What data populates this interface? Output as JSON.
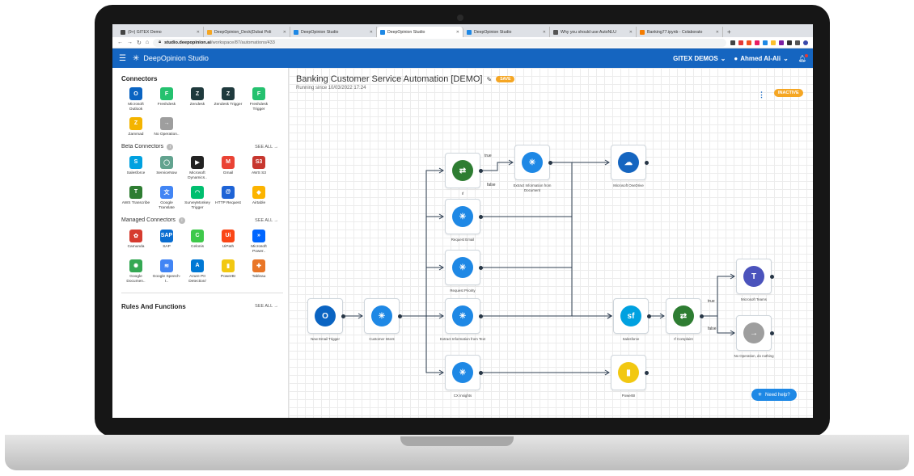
{
  "browser": {
    "tabs": [
      {
        "title": "(9+) GITEX Demo",
        "color": "#444"
      },
      {
        "title": "DeepOpinion_Deck(Dubai Poli",
        "color": "#f5a623"
      },
      {
        "title": "DeepOpinion Studio",
        "color": "#1e88e5"
      },
      {
        "title": "DeepOpinion Studio",
        "color": "#1e88e5"
      },
      {
        "title": "DeepOpinion Studio",
        "color": "#1e88e5"
      },
      {
        "title": "Why you should use AutoNLU",
        "color": "#555"
      },
      {
        "title": "Banking77.ipynb - Colaborato",
        "color": "#f57c00"
      }
    ],
    "active_tab": 3,
    "url_host": "studio.deepopinion.ai",
    "url_path": "/workspace/87/automations/433"
  },
  "header": {
    "brand": "DeepOpinion Studio",
    "workspace": "GITEX DEMOS",
    "user": "Ahmed Al-Ali"
  },
  "sidebar": {
    "connectors_title": "Connectors",
    "connectors": [
      {
        "label": "Microsoft Outlook",
        "icon": "outlook-icon",
        "color": "#0a64c2",
        "glyph": "O"
      },
      {
        "label": "Freshdesk",
        "icon": "freshdesk-icon",
        "color": "#25c16f",
        "glyph": "F"
      },
      {
        "label": "Zendesk",
        "icon": "zendesk-icon",
        "color": "#1f3a3d",
        "glyph": "Z"
      },
      {
        "label": "Zendesk Trigger",
        "icon": "zendesk-icon",
        "color": "#1f3a3d",
        "glyph": "Z"
      },
      {
        "label": "Freshdesk Trigger",
        "icon": "freshdesk-icon",
        "color": "#25c16f",
        "glyph": "F"
      },
      {
        "label": "Zammad",
        "icon": "zammad-icon",
        "color": "#f4b400",
        "glyph": "Z"
      },
      {
        "label": "No Operation..",
        "icon": "arrow-right-icon",
        "color": "#9e9e9e",
        "glyph": "→"
      }
    ],
    "beta_title": "Beta Connectors",
    "beta_see_all": "SEE ALL  →",
    "beta": [
      {
        "label": "Salesforce",
        "icon": "salesforce-icon",
        "color": "#00a1e0",
        "glyph": "S"
      },
      {
        "label": "ServiceNow",
        "icon": "servicenow-icon",
        "color": "#62a38f",
        "glyph": "◯"
      },
      {
        "label": "Microsoft Dynamics..",
        "icon": "dynamics-icon",
        "color": "#222",
        "glyph": "▶"
      },
      {
        "label": "Gmail",
        "icon": "gmail-icon",
        "color": "#ea4335",
        "glyph": "M"
      },
      {
        "label": "AWS S3",
        "icon": "aws-s3-icon",
        "color": "#c7372f",
        "glyph": "S3"
      },
      {
        "label": "AWS Transcribe",
        "icon": "aws-transcribe-icon",
        "color": "#2e7d32",
        "glyph": "T"
      },
      {
        "label": "Google Translate",
        "icon": "google-translate-icon",
        "color": "#4285f4",
        "glyph": "文"
      },
      {
        "label": "SurveyMonkey Trigger",
        "icon": "surveymonkey-icon",
        "color": "#00bf6f",
        "glyph": "◠"
      },
      {
        "label": "HTTP Request",
        "icon": "http-icon",
        "color": "#1e63d6",
        "glyph": "@"
      },
      {
        "label": "Airtable",
        "icon": "airtable-icon",
        "color": "#fcb400",
        "glyph": "◆"
      }
    ],
    "managed_title": "Managed Connectors",
    "managed_see_all": "SEE ALL  →",
    "managed": [
      {
        "label": "Camunda",
        "icon": "camunda-icon",
        "color": "#d63b2f",
        "glyph": "✿"
      },
      {
        "label": "SAP",
        "icon": "sap-icon",
        "color": "#0a6ed1",
        "glyph": "SAP"
      },
      {
        "label": "Celonis",
        "icon": "celonis-icon",
        "color": "#3ec94a",
        "glyph": "C"
      },
      {
        "label": "UiPath",
        "icon": "uipath-icon",
        "color": "#fa4616",
        "glyph": "Ui"
      },
      {
        "label": "Microsoft Power..",
        "icon": "power-automate-icon",
        "color": "#0066ff",
        "glyph": "»"
      },
      {
        "label": "Google Documen..",
        "icon": "google-docai-icon",
        "color": "#34a853",
        "glyph": "✺"
      },
      {
        "label": "Google Speech-t..",
        "icon": "google-speech-icon",
        "color": "#4285f4",
        "glyph": "≋"
      },
      {
        "label": "Azure PII Detection/",
        "icon": "azure-icon",
        "color": "#0078d4",
        "glyph": "A"
      },
      {
        "label": "PowerBI",
        "icon": "powerbi-icon",
        "color": "#f2c811",
        "glyph": "▮"
      },
      {
        "label": "Tableau",
        "icon": "tableau-icon",
        "color": "#e97627",
        "glyph": "✚"
      }
    ],
    "rules_title": "Rules And Functions",
    "rules_see_all": "SEE ALL  →"
  },
  "canvas": {
    "title": "Banking Customer Service Automation [DEMO]",
    "save_label": "SAVE",
    "subtitle": "Running since 10/03/2022 17:24",
    "status": "INACTIVE",
    "help": "Need help?",
    "nodes": [
      {
        "id": "outlook",
        "label": "New Email Trigger",
        "icon": "outlook-icon",
        "color": "#0a64c2",
        "glyph": "O"
      },
      {
        "id": "intent",
        "label": "Customer Intent",
        "icon": "deepopinion-icon",
        "color": "#1e88e5",
        "glyph": "✳"
      },
      {
        "id": "if1",
        "label": "If",
        "icon": "signpost-icon",
        "color": "#2e7d32",
        "glyph": "⇄"
      },
      {
        "id": "extract_doc",
        "label": "Extract Information from Document",
        "icon": "deepopinion-icon",
        "color": "#1e88e5",
        "glyph": "✳"
      },
      {
        "id": "onedrive",
        "label": "Microsoft OneDrive",
        "icon": "onedrive-icon",
        "color": "#1565c0",
        "glyph": "☁"
      },
      {
        "id": "req_email",
        "label": "Request Email",
        "icon": "deepopinion-icon",
        "color": "#1e88e5",
        "glyph": "✳"
      },
      {
        "id": "req_priority",
        "label": "Request Priority",
        "icon": "deepopinion-icon",
        "color": "#1e88e5",
        "glyph": "✳"
      },
      {
        "id": "extract_text",
        "label": "Extract Information from Text",
        "icon": "deepopinion-icon",
        "color": "#1e88e5",
        "glyph": "✳"
      },
      {
        "id": "cx",
        "label": "CX Insights",
        "icon": "deepopinion-icon",
        "color": "#1e88e5",
        "glyph": "✳"
      },
      {
        "id": "salesforce",
        "label": "Salesforce",
        "icon": "salesforce-icon",
        "color": "#00a1e0",
        "glyph": "sf"
      },
      {
        "id": "if2",
        "label": "If Complaint",
        "icon": "signpost-icon",
        "color": "#2e7d32",
        "glyph": "⇄"
      },
      {
        "id": "teams",
        "label": "Microsoft Teams",
        "icon": "teams-icon",
        "color": "#4b53bc",
        "glyph": "T"
      },
      {
        "id": "noop",
        "label": "No Operation, do nothing",
        "icon": "arrow-right-icon",
        "color": "#9e9e9e",
        "glyph": "→"
      },
      {
        "id": "powerbi",
        "label": "PowerBI",
        "icon": "powerbi-icon",
        "color": "#f2c811",
        "glyph": "▮"
      }
    ],
    "edge_labels": {
      "true": "true",
      "false": "false"
    }
  }
}
